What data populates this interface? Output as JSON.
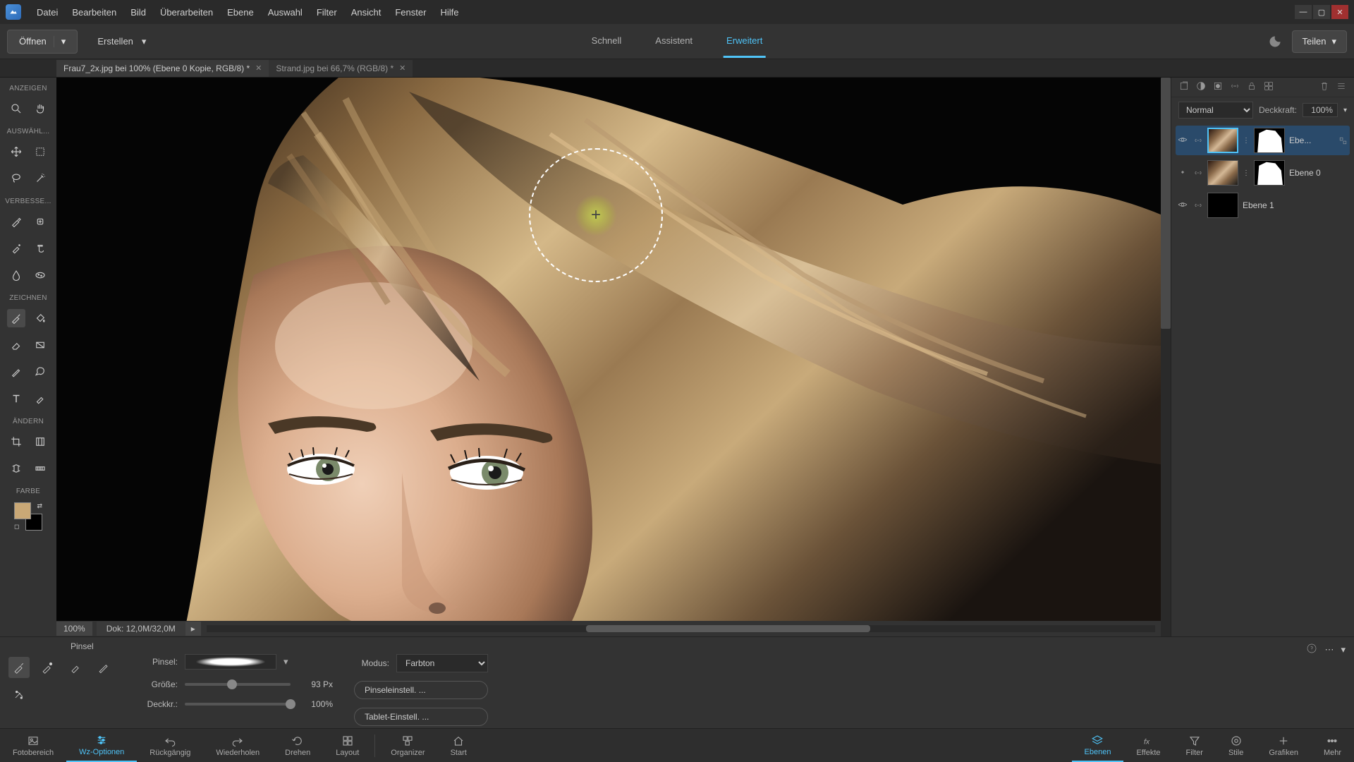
{
  "menubar": [
    "Datei",
    "Bearbeiten",
    "Bild",
    "Überarbeiten",
    "Ebene",
    "Auswahl",
    "Filter",
    "Ansicht",
    "Fenster",
    "Hilfe"
  ],
  "actionbar": {
    "open": "Öffnen",
    "create": "Erstellen",
    "modes": [
      "Schnell",
      "Assistent",
      "Erweitert"
    ],
    "active_mode": 2,
    "share": "Teilen"
  },
  "doctabs": [
    {
      "label": "Frau7_2x.jpg bei 100% (Ebene 0 Kopie, RGB/8) *",
      "active": true
    },
    {
      "label": "Strand.jpg bei 66,7% (RGB/8) *",
      "active": false
    }
  ],
  "lefttool_sections": {
    "anzeigen": "ANZEIGEN",
    "auswahl": "AUSWÄHL...",
    "verbessern": "VERBESSE...",
    "zeichnen": "ZEICHNEN",
    "aendern": "ÄNDERN",
    "farbe": "FARBE"
  },
  "colors": {
    "fg": "#c9a876",
    "bg": "#000000"
  },
  "canvas": {
    "zoom": "100%",
    "dok": "Dok: 12,0M/32,0M"
  },
  "brush_cursor_visible": true,
  "blend": {
    "mode": "Normal",
    "opacity_label": "Deckkraft:",
    "opacity_value": "100%"
  },
  "layers": [
    {
      "name": "Ebe...",
      "has_mask": true,
      "visible": true,
      "linked": true,
      "icons": true,
      "selected": true
    },
    {
      "name": "Ebene 0",
      "has_mask": true,
      "visible": false,
      "linked": true,
      "selected": false
    },
    {
      "name": "Ebene 1",
      "has_mask": false,
      "visible": true,
      "linked": true,
      "black": true,
      "selected": false
    }
  ],
  "tooloptions": {
    "title": "Pinsel",
    "brush_label": "Pinsel:",
    "size_label": "Größe:",
    "size_value": "93 Px",
    "size_pct": 40,
    "opacity_label": "Deckkr.:",
    "opacity_value": "100%",
    "opacity_pct": 100,
    "mode_label": "Modus:",
    "mode_value": "Farbton",
    "btn_brush_settings": "Pinseleinstell. ...",
    "btn_tablet_settings": "Tablet-Einstell. ..."
  },
  "bottombar_left": [
    {
      "label": "Fotobereich",
      "icon": "image"
    },
    {
      "label": "Wz-Optionen",
      "icon": "sliders",
      "active": true
    },
    {
      "label": "Rückgängig",
      "icon": "undo"
    },
    {
      "label": "Wiederholen",
      "icon": "redo"
    },
    {
      "label": "Drehen",
      "icon": "rotate"
    },
    {
      "label": "Layout",
      "icon": "grid"
    }
  ],
  "bottombar_mid": [
    {
      "label": "Organizer",
      "icon": "boxes"
    },
    {
      "label": "Start",
      "icon": "home"
    }
  ],
  "bottombar_right": [
    {
      "label": "Ebenen",
      "icon": "layers",
      "active": true
    },
    {
      "label": "Effekte",
      "icon": "fx"
    },
    {
      "label": "Filter",
      "icon": "funnel"
    },
    {
      "label": "Stile",
      "icon": "style"
    },
    {
      "label": "Grafiken",
      "icon": "plus"
    },
    {
      "label": "Mehr",
      "icon": "dots"
    }
  ]
}
